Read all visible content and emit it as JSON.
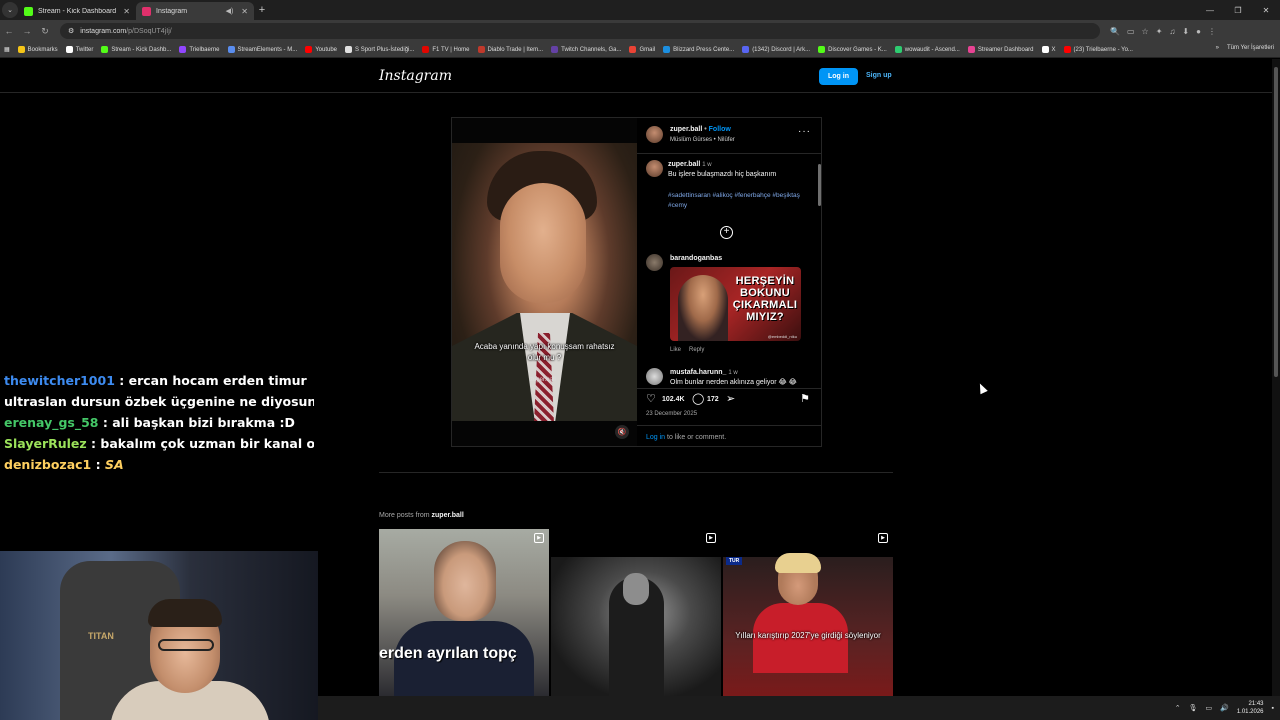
{
  "browser": {
    "tabs": [
      {
        "title": "Stream - Kick Dashboard",
        "favicon_color": "#53fc18"
      },
      {
        "title": "Instagram",
        "favicon_color": "#e1306c"
      }
    ],
    "url_host": "instagram.com",
    "url_path": "/p/DSoqUT4jIj/",
    "bookmarks": [
      {
        "label": "Bookmarks",
        "icon": "star-icon"
      },
      {
        "label": "Twitter",
        "icon": "x-icon"
      },
      {
        "label": "Stream - Kick Dashb...",
        "icon": "kick-icon"
      },
      {
        "label": "Trielbaerne",
        "icon": "twitch-icon"
      },
      {
        "label": "StreamElements - M...",
        "icon": "streamelements-icon"
      },
      {
        "label": "Youtube",
        "icon": "youtube-icon"
      },
      {
        "label": "S Sport Plus-İstediği...",
        "icon": "ssport-icon"
      },
      {
        "label": "F1 TV | Home",
        "icon": "f1-icon"
      },
      {
        "label": "Diablo Trade | Item...",
        "icon": "diablo-icon"
      },
      {
        "label": "Twitch Channels, Ga...",
        "icon": "twitchtracker-icon"
      },
      {
        "label": "Gmail",
        "icon": "gmail-icon"
      },
      {
        "label": "Blizzard Press Cente...",
        "icon": "blizzard-icon"
      },
      {
        "label": "(1342) Discord | Ark...",
        "icon": "discord-icon"
      },
      {
        "label": "Discover Games - K...",
        "icon": "kick-icon"
      },
      {
        "label": "wowaudit - Ascend...",
        "icon": "wowaudit-icon"
      },
      {
        "label": "Streamer Dashboard",
        "icon": "dashboard-icon"
      },
      {
        "label": "X",
        "icon": "x-icon"
      },
      {
        "label": "(23) Trielbaerne - Yo...",
        "icon": "youtube-icon"
      }
    ],
    "bookmarks_overflow": "»",
    "all_bookmarks": "Tüm Yer İşaretleri"
  },
  "instagram": {
    "logo": "Instagram",
    "login": "Log in",
    "signup": "Sign up",
    "post": {
      "overlay_caption": "Acaba yanında yapı konuşsam rahatsız olur mu ?",
      "watermark": "zuper.ball",
      "username": "zuper.ball",
      "follow_sep": "•",
      "follow": "Follow",
      "audio": "Müslüm Gürses • Nilüfer",
      "caption_user": "zuper.ball",
      "caption_time": "1 w",
      "caption_text": "Bu işlere bulaşmazdı hiç başkanım",
      "hashtags": "#sadettinsaran #alikoç #fenerbahçe #beşiktaş #cemy",
      "comment1_user": "barandoganbas",
      "gif_text": "HERŞEYİN BOKUNU ÇIKARMALI MIYIZ?",
      "gif_credit": "@embeddi_ntku",
      "like_action": "Like",
      "reply_action": "Reply",
      "comment2_user": "mustafa.harunn_",
      "comment2_time": "1 w",
      "comment2_text": "Olm bunlar nerden aklınıza geliyor 😂 😂",
      "likes": "102.4K",
      "comments_count": "172",
      "date": "23 December 2025",
      "login_link": "Log in",
      "login_suffix": " to like or comment."
    },
    "more_posts_prefix": "More posts from ",
    "more_posts_user": "zuper.ball",
    "tiles": [
      {
        "overlay_text": "erden ayrılan topç"
      },
      {
        "overlay_text": ""
      },
      {
        "badge": "TUR",
        "overlay_text": "Yılları karıştırıp 2027'ye girdiği söyleniyor"
      }
    ]
  },
  "chat": {
    "messages": [
      {
        "user": "thewitcher1001",
        "color": "#3d8bf0",
        "text": "ercan hocam erden timur"
      },
      {
        "user": "",
        "color": "#ffffff",
        "text": "ultraslan dursun özbek üçgenine ne diyosun"
      },
      {
        "user": "erenay_gs_58",
        "color": "#44c767",
        "text": "ali başkan bizi bırakma :D"
      },
      {
        "user": "SlayerRulez",
        "color": "#9be15a",
        "text": "bakalım çok uzman bir kanal o"
      },
      {
        "user": "denizbozac1",
        "color": "#ffd060",
        "text": "SA"
      }
    ]
  },
  "webcam": {
    "chair_brand": "TITAN"
  },
  "taskbar": {
    "time": "21:43",
    "date": "1.01.2026"
  }
}
